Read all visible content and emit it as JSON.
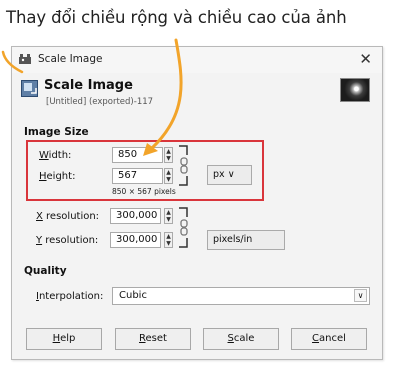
{
  "caption": "Thay đổi chiều rộng và chiều cao của ảnh",
  "window": {
    "title": "Scale Image",
    "close": "✕"
  },
  "header": {
    "title": "Scale Image",
    "subtitle": "[Untitled] (exported)-117"
  },
  "image_size": {
    "section_label": "Image Size",
    "width": {
      "label_first": "W",
      "label_rest": "idth:",
      "value": "850"
    },
    "height": {
      "label_first": "H",
      "label_rest": "eight:",
      "value": "567"
    },
    "pixels_note": "850 × 567 pixels",
    "unit": "px"
  },
  "resolution": {
    "x": {
      "label_first": "X",
      "label_rest": " resolution:",
      "value": "300,000"
    },
    "y": {
      "label_first": "Y",
      "label_rest": " resolution:",
      "value": "300,000"
    },
    "unit": "pixels/in"
  },
  "quality": {
    "section_label": "Quality",
    "interpolation": {
      "label_first": "I",
      "label_rest": "nterpolation:",
      "value": "Cubic"
    }
  },
  "buttons": {
    "help": {
      "first": "H",
      "rest": "elp"
    },
    "reset": {
      "first": "R",
      "rest": "eset"
    },
    "scale": {
      "first": "S",
      "rest": "cale"
    },
    "cancel": {
      "first": "C",
      "rest": "ancel"
    }
  },
  "colors": {
    "highlight": "#d9353b",
    "arrow": "#f2a42a"
  },
  "icons": {
    "app": "gimp-wilber-icon",
    "dropdown": "chevron-down-icon",
    "chain": "chain-link-icon"
  }
}
